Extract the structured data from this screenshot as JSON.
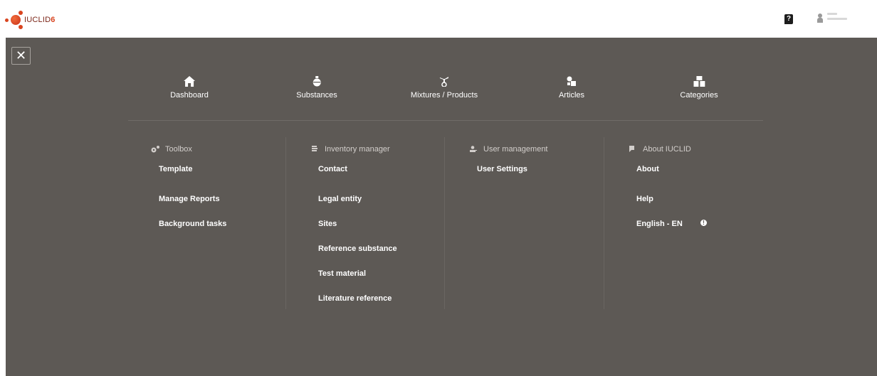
{
  "app": {
    "logo_text": "IUCLID",
    "logo_version": "6",
    "brand_color": "#d9441f"
  },
  "header": {
    "help_label": "?",
    "user_icon": "user-icon"
  },
  "panel": {
    "background": "#5d5955",
    "close_label": "✕"
  },
  "nav": [
    {
      "label": "Dashboard",
      "icon": "home-icon"
    },
    {
      "label": "Substances",
      "icon": "flask-icon"
    },
    {
      "label": "Mixtures / Products",
      "icon": "mixtures-icon"
    },
    {
      "label": "Articles",
      "icon": "articles-icon"
    },
    {
      "label": "Categories",
      "icon": "categories-icon"
    }
  ],
  "sections": [
    {
      "title": "Toolbox",
      "icon": "gears-icon",
      "items": [
        "Template",
        "Manage Reports",
        "Background tasks"
      ]
    },
    {
      "title": "Inventory manager",
      "icon": "inventory-icon",
      "items": [
        "Contact",
        "Legal entity",
        "Sites",
        "Reference substance",
        "Test material",
        "Literature reference"
      ]
    },
    {
      "title": "User management",
      "icon": "user-management-icon",
      "items": [
        "User Settings"
      ]
    },
    {
      "title": "About IUCLID",
      "icon": "comment-icon",
      "items": [
        "About",
        "Help",
        "English - EN"
      ],
      "info_badge": "!"
    }
  ]
}
